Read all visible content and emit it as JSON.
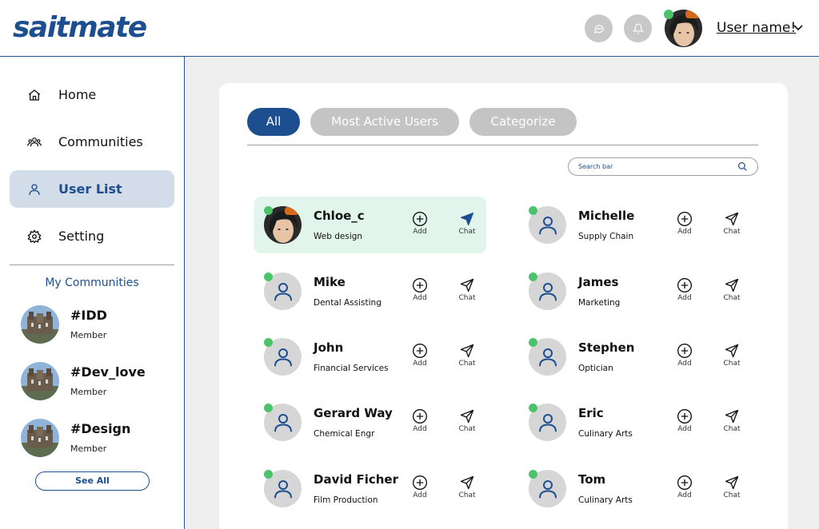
{
  "header": {
    "logo": "saitmate",
    "username": "User name!",
    "icons": [
      "chat-icon",
      "bell-icon",
      "chevron-down-icon"
    ]
  },
  "sidebar": {
    "items": [
      {
        "label": "Home",
        "icon": "home-icon"
      },
      {
        "label": "Communities",
        "icon": "users-icon"
      },
      {
        "label": "User List",
        "icon": "user-icon",
        "active": true
      },
      {
        "label": "Setting",
        "icon": "gear-icon"
      }
    ],
    "communities_title": "My Communities",
    "communities": [
      {
        "name": "#IDD",
        "role": "Member"
      },
      {
        "name": "#Dev_love",
        "role": "Member"
      },
      {
        "name": "#Design",
        "role": "Member"
      }
    ],
    "see_all": "See All"
  },
  "main": {
    "tabs": [
      {
        "label": "All",
        "active": true
      },
      {
        "label": "Most Active Users"
      },
      {
        "label": "Categorize"
      }
    ],
    "search": {
      "placeholder": "Search bar"
    },
    "action_labels": {
      "add": "Add",
      "chat": "Chat"
    },
    "users": [
      {
        "name": "Chloe_c",
        "role": "Web design",
        "online": true,
        "photo": true,
        "highlight": true
      },
      {
        "name": "Michelle",
        "role": "Supply Chain",
        "online": true
      },
      {
        "name": "Mike",
        "role": "Dental Assisting",
        "online": true
      },
      {
        "name": "James",
        "role": "Marketing",
        "online": true
      },
      {
        "name": "John",
        "role": "Financial Services",
        "online": true
      },
      {
        "name": "Stephen",
        "role": "Optician",
        "online": true
      },
      {
        "name": "Gerard Way",
        "role": "Chemical Engr",
        "online": true
      },
      {
        "name": "Eric",
        "role": "Culinary Arts",
        "online": true
      },
      {
        "name": "David Ficher",
        "role": "Film Production",
        "online": true
      },
      {
        "name": "Tom",
        "role": "Culinary Arts",
        "online": true
      }
    ]
  },
  "colors": {
    "brand": "#1d4e8f",
    "online": "#4cc36a",
    "active_nav_bg": "#d3dde9",
    "highlight_card_bg": "#e2f5ec",
    "tab_inactive": "#c4c4c4"
  }
}
